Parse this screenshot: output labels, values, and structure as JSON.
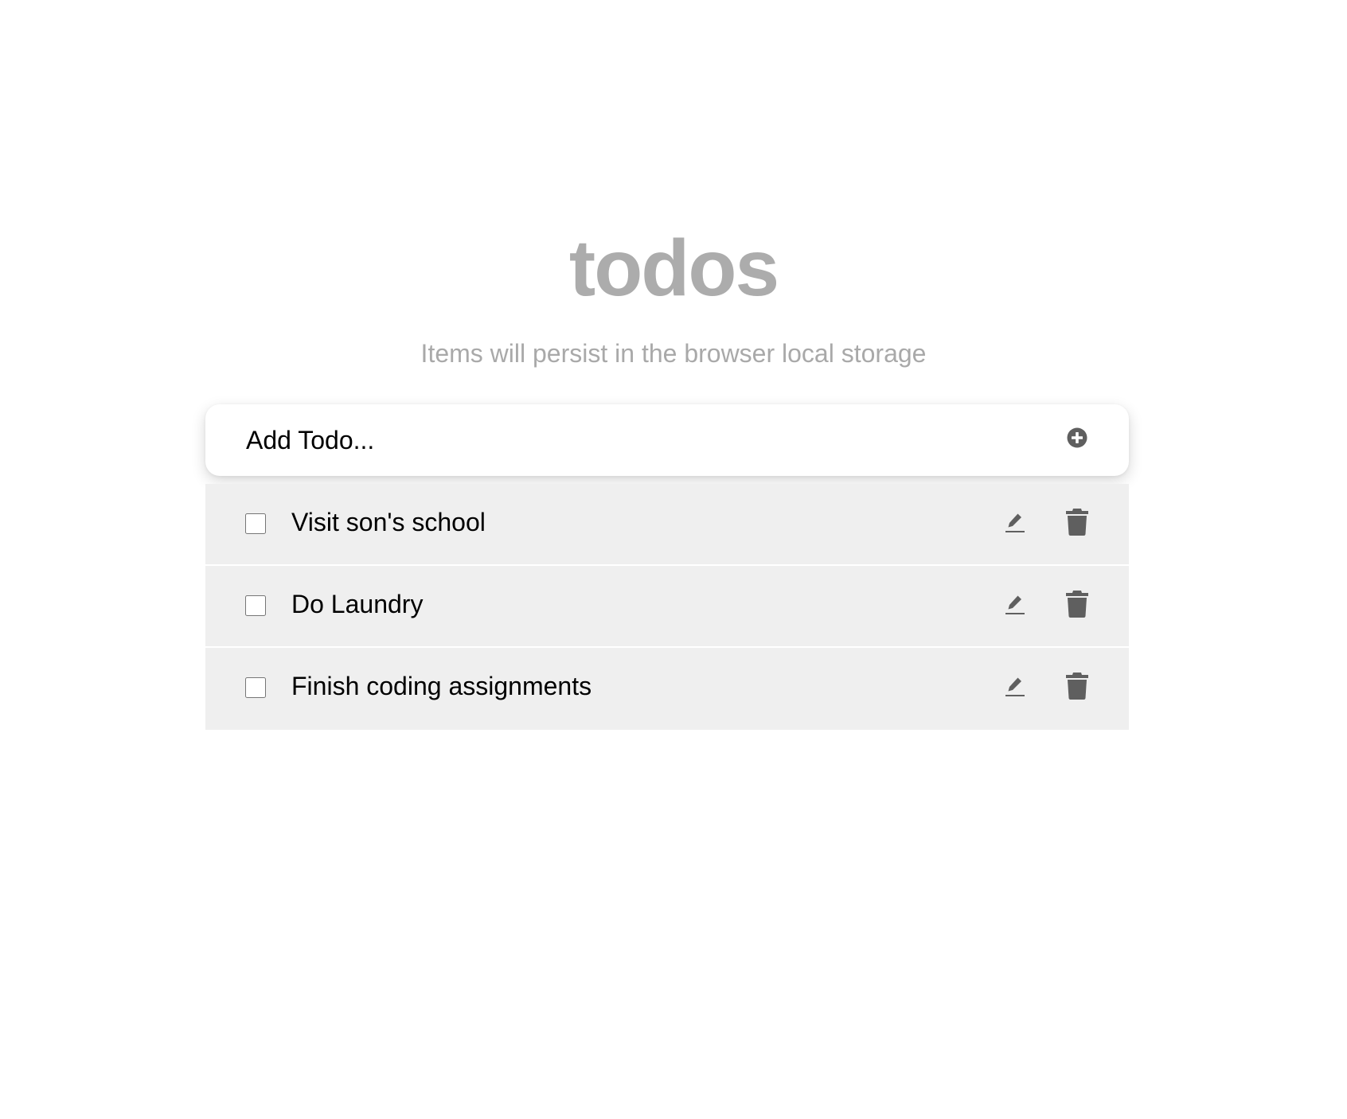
{
  "header": {
    "title": "todos",
    "subtitle": "Items will persist in the browser local storage"
  },
  "add_todo": {
    "placeholder": "Add Todo...",
    "value": "",
    "add_icon": "plus-circle-icon"
  },
  "todos": [
    {
      "text": "Visit son's school",
      "completed": false,
      "edit_icon": "pencil-icon",
      "delete_icon": "trash-icon"
    },
    {
      "text": "Do Laundry",
      "completed": false,
      "edit_icon": "pencil-icon",
      "delete_icon": "trash-icon"
    },
    {
      "text": "Finish coding assignments",
      "completed": false,
      "edit_icon": "pencil-icon",
      "delete_icon": "trash-icon"
    }
  ],
  "colors": {
    "title": "#acacac",
    "subtitle": "#a9a9a9",
    "row_background": "#efefef",
    "icon": "#5f5f5f",
    "text": "#000000"
  }
}
